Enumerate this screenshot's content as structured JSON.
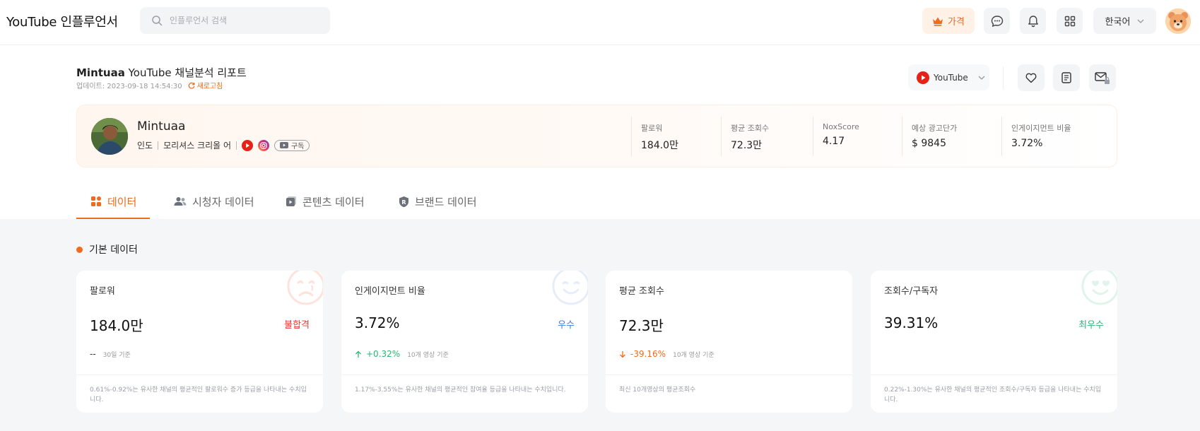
{
  "colors": {
    "accent": "#f26a1b",
    "fail": "#e53935",
    "good": "#3b7ddd",
    "best": "#2bb673",
    "down": "#f26a1b",
    "up": "#2bb673"
  },
  "topbar": {
    "brand": "YouTube 인플루언서",
    "search_placeholder": "인플루언서 검색",
    "price_label": "가격",
    "lang_label": "한국어",
    "icons": [
      "crown-icon",
      "chat-icon",
      "bell-icon",
      "grid-icon",
      "chevron-down-icon"
    ]
  },
  "report": {
    "channel": "Mintuaa",
    "title_suffix": "YouTube 채널분석 리포트",
    "update_label": "업데이트: 2023-09-18 14:54:30",
    "refresh_label": "새로고침",
    "platform": "YouTube"
  },
  "profile": {
    "name": "Mintuaa",
    "country": "인도",
    "language": "모리셔스 크리올 어",
    "subscribe_label": "구독",
    "stats": [
      {
        "label": "팔로워",
        "value": "184.0만"
      },
      {
        "label": "평균 조회수",
        "value": "72.3만"
      },
      {
        "label": "NoxScore",
        "value": "4.17"
      },
      {
        "label": "예상 광고단가",
        "value": "$ 9845"
      },
      {
        "label": "인게이지먼트 비율",
        "value": "3.72%"
      }
    ]
  },
  "tabs": [
    {
      "label": "데이터",
      "active": true
    },
    {
      "label": "시청자 데이터",
      "active": false
    },
    {
      "label": "콘텐츠 데이터",
      "active": false
    },
    {
      "label": "브랜드 데이터",
      "active": false
    }
  ],
  "section": {
    "title": "기본 데이터"
  },
  "cards": [
    {
      "title": "팔로워",
      "value": "184.0만",
      "grade": "불합격",
      "trend_value": "--",
      "trend_note": "30일 기준",
      "footnote": "0.61%-0.92%는 유사한 채널의 평균적인 팔로워수 증가 등급을 나타내는 수치입니다."
    },
    {
      "title": "인게이지먼트 비율",
      "value": "3.72%",
      "grade": "우수",
      "trend_value": "+0.32%",
      "trend_note": "10개 영상 기준",
      "footnote": "1.17%-3.55%는 유사한 채널의 평균적인 참여율 등급을 나타내는 수치입니다."
    },
    {
      "title": "평균 조회수",
      "value": "72.3만",
      "grade": "",
      "trend_value": "-39.16%",
      "trend_note": "10개 영상 기준",
      "footnote": "최신 10개영상의 평균조회수"
    },
    {
      "title": "조회수/구독자",
      "value": "39.31%",
      "grade": "최우수",
      "trend_value": "",
      "trend_note": "",
      "footnote": "0.22%-1.30%는 유사한 채널의 평균적인 조회수/구독자 등급을 나타내는 수치입니다."
    }
  ]
}
